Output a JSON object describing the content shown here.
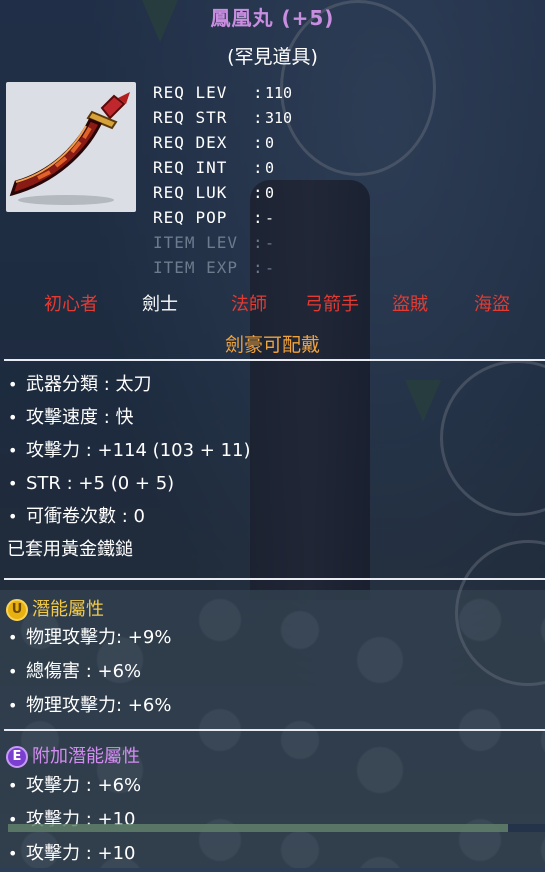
{
  "item": {
    "name": "鳳凰丸 (+5)",
    "rarity": "(罕見道具)",
    "icon": "curved-sword-icon"
  },
  "requirements": [
    {
      "label": "REQ LEV",
      "value": "110",
      "dim": false
    },
    {
      "label": "REQ STR",
      "value": "310",
      "dim": false
    },
    {
      "label": "REQ DEX",
      "value": "0",
      "dim": false
    },
    {
      "label": "REQ INT",
      "value": "0",
      "dim": false
    },
    {
      "label": "REQ LUK",
      "value": "0",
      "dim": false
    },
    {
      "label": "REQ POP",
      "value": "-",
      "dim": false
    },
    {
      "label": "ITEM LEV",
      "value": "-",
      "dim": true
    },
    {
      "label": "ITEM EXP",
      "value": "-",
      "dim": true
    }
  ],
  "jobs": [
    {
      "label": "初心者",
      "allowed": false
    },
    {
      "label": "劍士",
      "allowed": true
    },
    {
      "label": "法師",
      "allowed": false
    },
    {
      "label": "弓箭手",
      "allowed": false
    },
    {
      "label": "盜賊",
      "allowed": false
    },
    {
      "label": "海盜",
      "allowed": false
    }
  ],
  "equip_note": "劍豪可配戴",
  "stats": [
    "武器分類 : 太刀",
    "攻擊速度 : 快",
    "攻擊力 : +114 (103 + 11)",
    "STR : +5 (0 + 5)",
    "可衝卷次數 : 0"
  ],
  "applied_note": "已套用黃金鐵鎚",
  "potential": {
    "badge": "U",
    "title": "潛能屬性",
    "lines": [
      "物理攻擊力: +9%",
      "總傷害 : +6%",
      "物理攻擊力: +6%"
    ]
  },
  "additional_potential": {
    "badge": "E",
    "title": "附加潛能屬性",
    "lines": [
      "攻擊力 : +6%",
      "攻擊力 : +10",
      "攻擊力 : +10"
    ]
  },
  "colors": {
    "title": "#c98ee0",
    "job_allowed": "#ffffff",
    "job_denied": "#e33a32",
    "equip_note": "#f0a23c",
    "potential_head": "#f1c94a",
    "additional_head": "#d38cf2"
  }
}
